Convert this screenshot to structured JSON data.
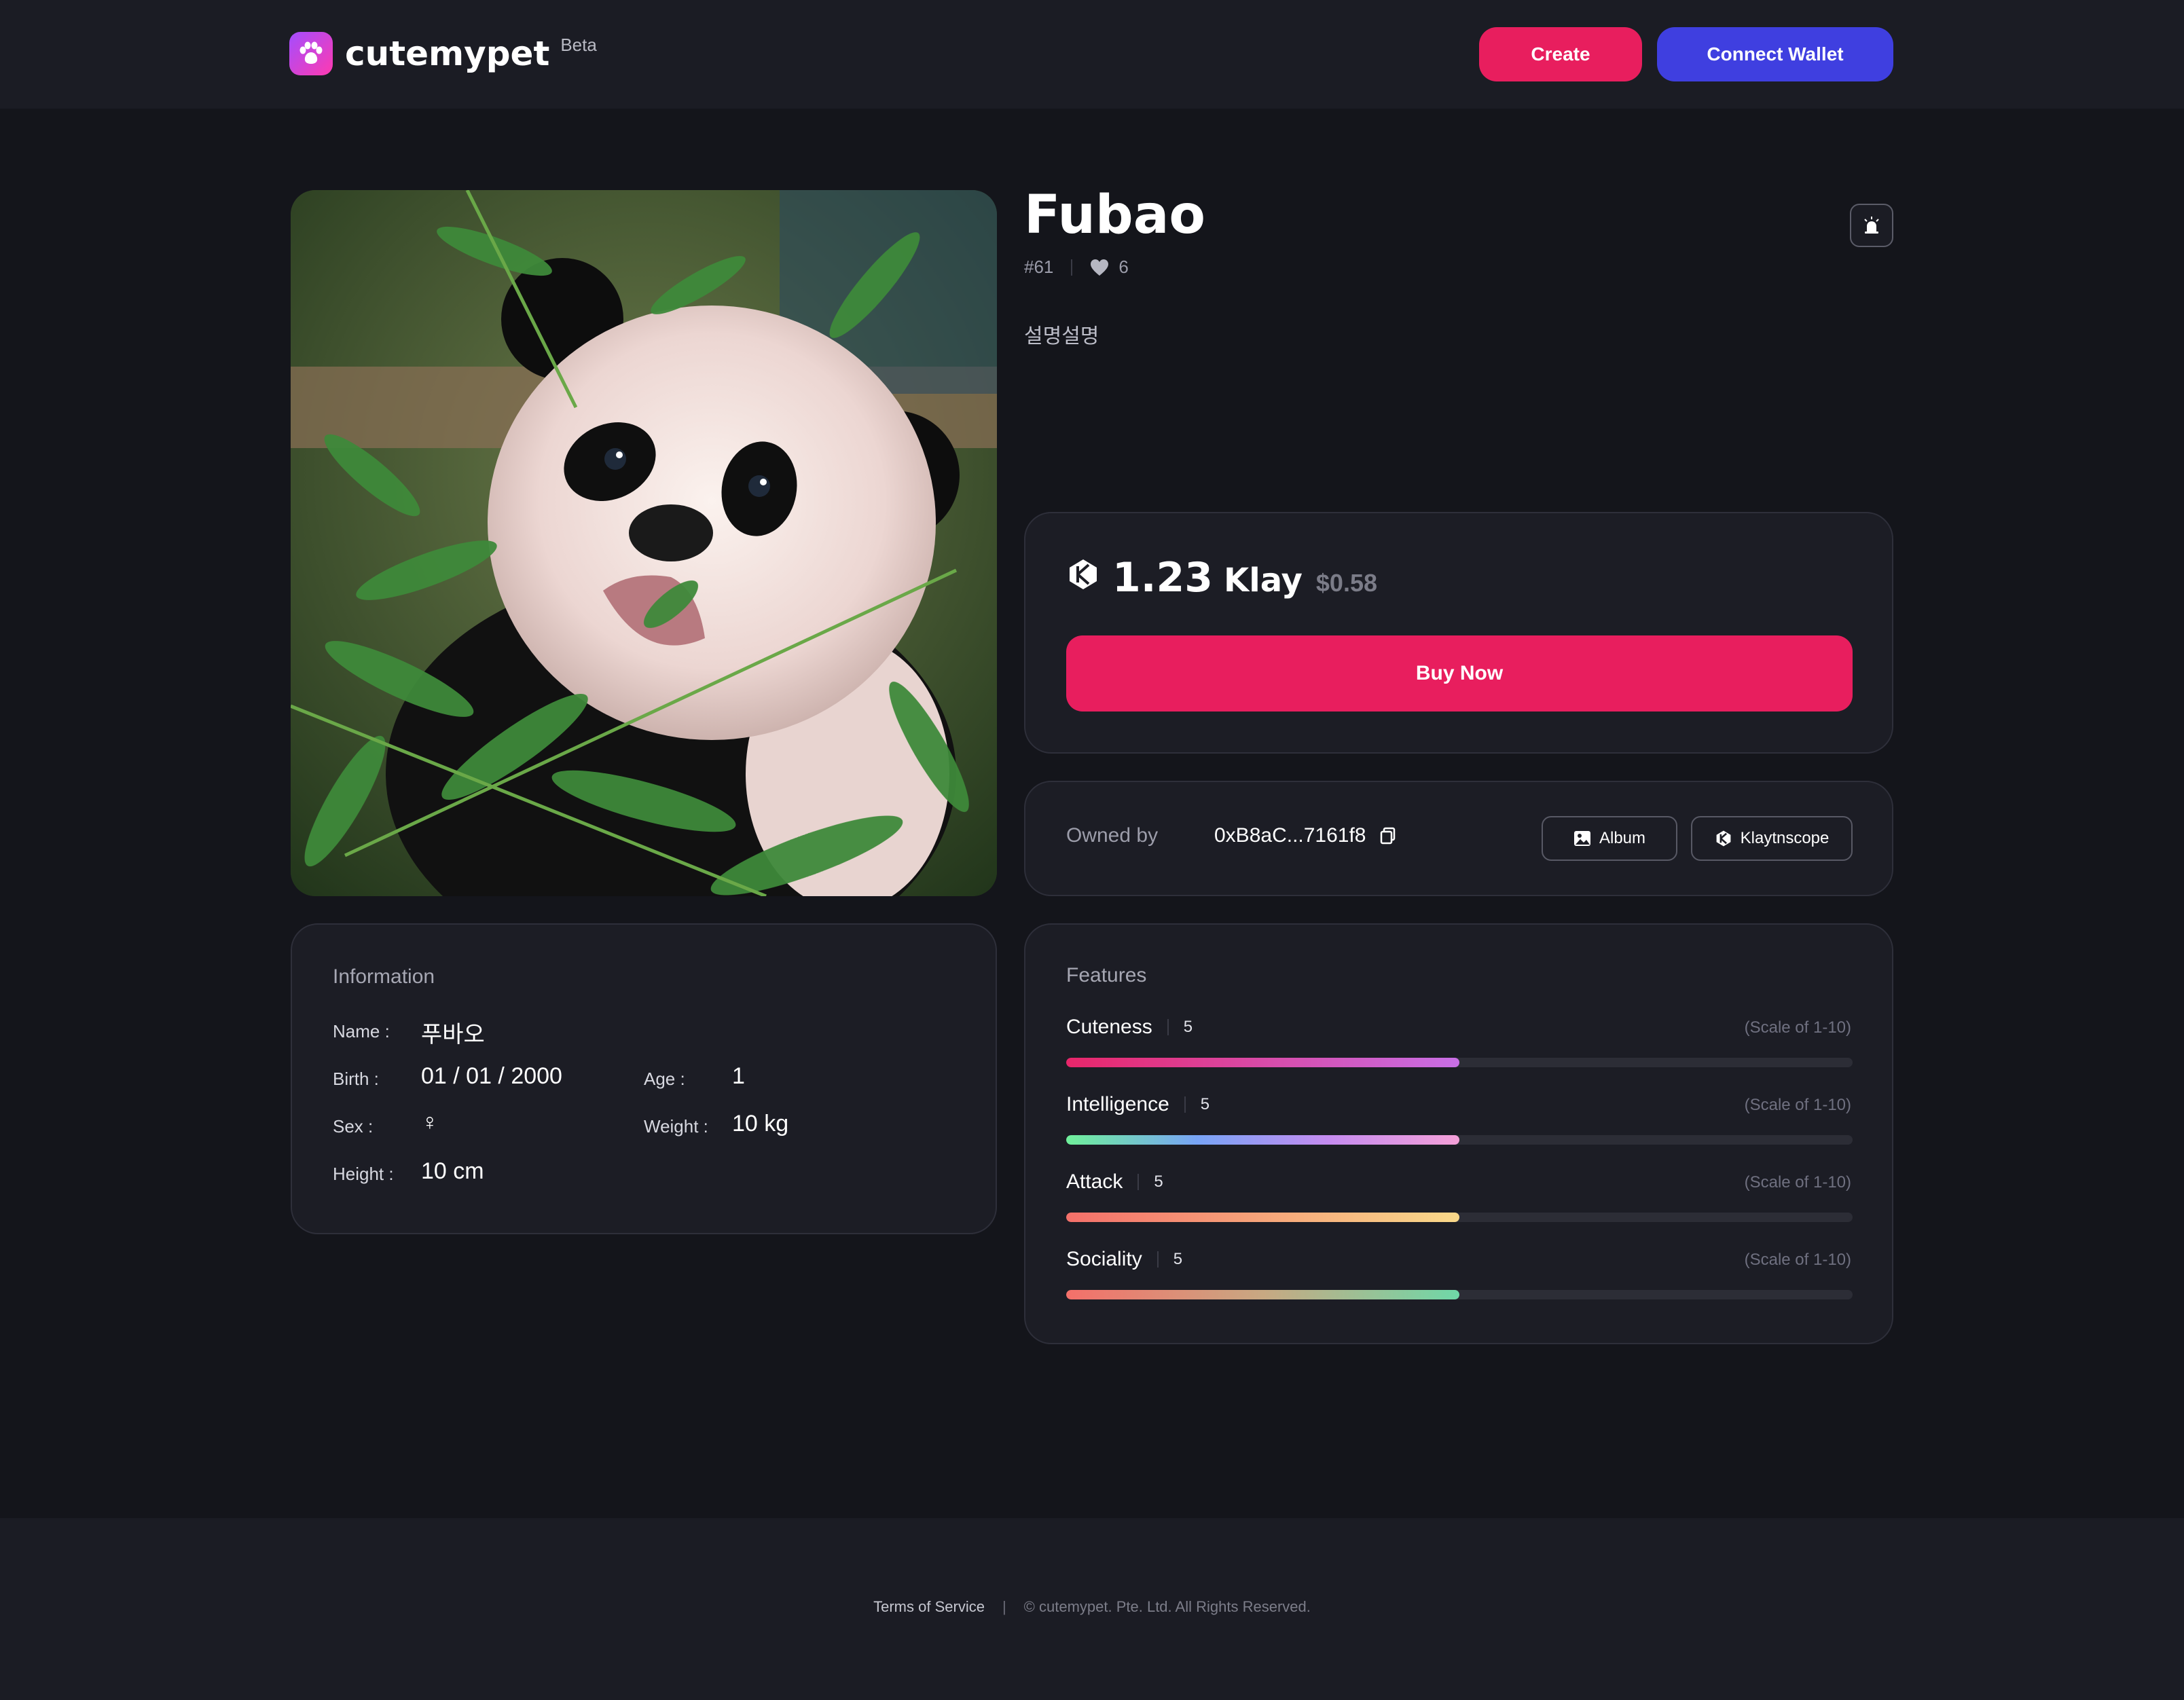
{
  "header": {
    "logo_text": "cutemypet",
    "beta_label": "Beta",
    "create_label": "Create",
    "wallet_label": "Connect Wallet"
  },
  "pet": {
    "name": "Fubao",
    "token_id": "#61",
    "likes": "6",
    "description": "설명설명",
    "image_alt": "panda cub eating bamboo"
  },
  "price": {
    "amount": "1.23",
    "unit": "Klay",
    "usd": "$0.58",
    "buy_label": "Buy Now"
  },
  "owner": {
    "label": "Owned by",
    "address": "0xB8aC...7161f8",
    "album_label": "Album",
    "klaytnscope_label": "Klaytnscope"
  },
  "information": {
    "title": "Information",
    "name_label": "Name :",
    "name_value": "푸바오",
    "birth_label": "Birth :",
    "birth_value": "01 / 01 / 2000",
    "age_label": "Age :",
    "age_value": "1",
    "sex_label": "Sex :",
    "sex_value": "♀",
    "weight_label": "Weight :",
    "weight_value": "10 kg",
    "height_label": "Height :",
    "height_value": "10 cm"
  },
  "features": {
    "title": "Features",
    "scale_label": "(Scale of 1-10)",
    "items": [
      {
        "name": "Cuteness",
        "value": "5",
        "level": 0.5
      },
      {
        "name": "Intelligence",
        "value": "5",
        "level": 0.5
      },
      {
        "name": "Attack",
        "value": "5",
        "level": 0.5
      },
      {
        "name": "Sociality",
        "value": "5",
        "level": 0.5
      }
    ]
  },
  "footer": {
    "terms": "Terms of Service",
    "separator": "|",
    "copyright": "© cutemypet. Pte. Ltd. All Rights Reserved."
  },
  "colors": {
    "accent_pink": "#e81e5e",
    "accent_blue": "#3f3fe0",
    "background": "#14151b"
  }
}
